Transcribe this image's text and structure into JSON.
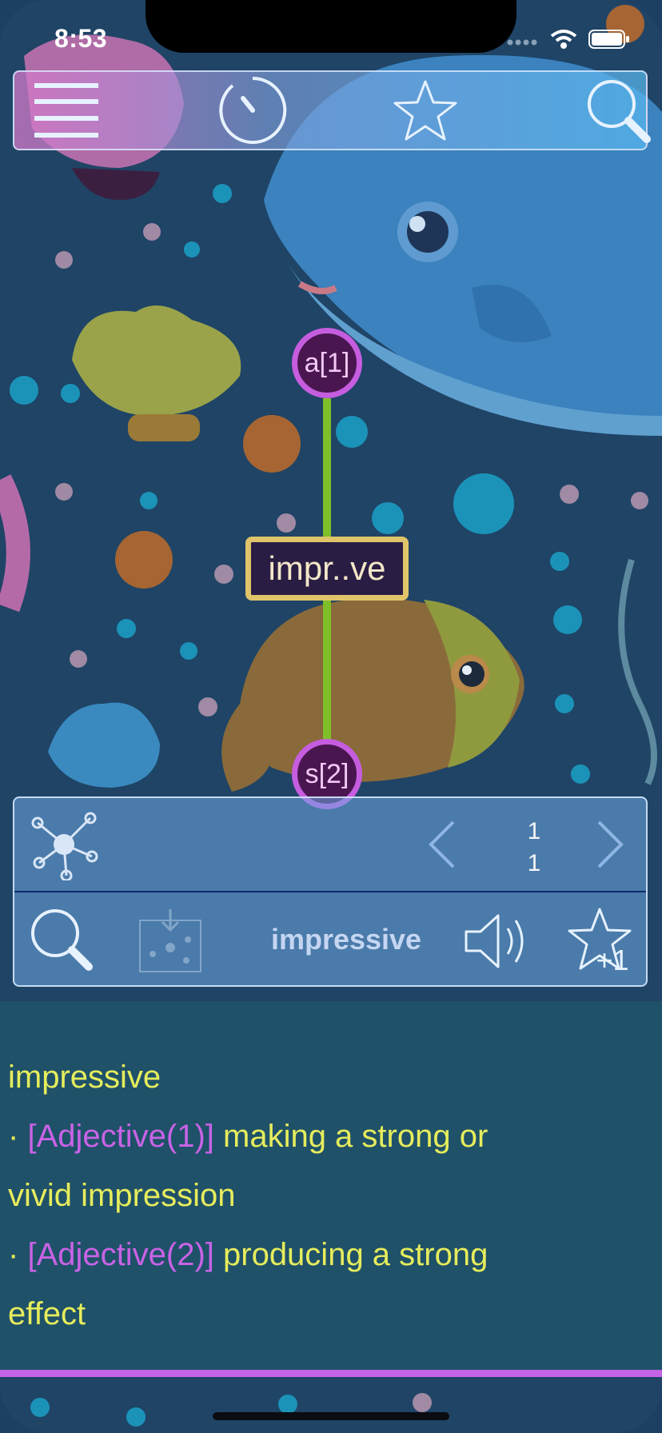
{
  "status_bar": {
    "time": "8:53"
  },
  "top_toolbar": {
    "icons": [
      "menu-icon",
      "timer-icon",
      "star-icon",
      "search-icon"
    ]
  },
  "graph": {
    "top_node": "a[1]",
    "center_node": "impr..ve",
    "bottom_node": "s[2]"
  },
  "word_panel": {
    "counter_top": "1",
    "counter_bottom": "1",
    "word": "impressive",
    "icons": [
      "network-icon",
      "chevron-left-icon",
      "chevron-right-icon",
      "search-icon",
      "import-network-icon",
      "speaker-icon",
      "star-plus-one-icon"
    ],
    "star_badge": "+1"
  },
  "definition": {
    "headword": "impressive",
    "bullet": "·",
    "senses": [
      {
        "pos": "[Adjective(1)]",
        "text": "making a strong or",
        "text_cont": "vivid impression"
      },
      {
        "pos": "[Adjective(2)]",
        "text": "producing a strong",
        "text_cont": "effect"
      }
    ]
  },
  "colors": {
    "accent": "#c563e6",
    "definition_text": "#e6ec5c",
    "node_border": "#c65ddf",
    "edge": "#7fbf2a",
    "center_border": "#e0c46a"
  }
}
